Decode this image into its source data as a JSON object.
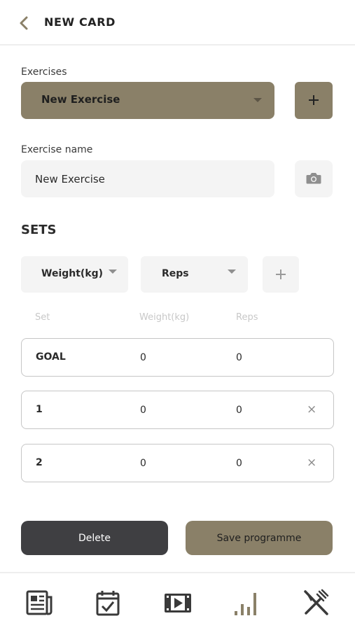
{
  "header": {
    "title": "NEW CARD",
    "back_icon": "chevron-left-icon"
  },
  "exercises": {
    "label": "Exercises",
    "selected": "New Exercise",
    "add_icon": "plus-icon"
  },
  "exercise_name": {
    "label": "Exercise name",
    "value": "New Exercise",
    "camera_icon": "camera-icon"
  },
  "sets": {
    "title": "SETS",
    "column_selectors": [
      {
        "value": "Weight(kg)"
      },
      {
        "value": "Reps"
      }
    ],
    "add_column_icon": "plus-icon",
    "headers": [
      "Set",
      "Weight(kg)",
      "Reps"
    ],
    "rows": [
      {
        "set": "GOAL",
        "weight": "0",
        "reps": "0",
        "removable": false
      },
      {
        "set": "1",
        "weight": "0",
        "reps": "0",
        "remove": "×"
      },
      {
        "set": "2",
        "weight": "0",
        "reps": "0",
        "remove": "×"
      }
    ]
  },
  "actions": {
    "delete_label": "Delete",
    "save_label": "Save programme"
  },
  "bottom_nav": {
    "items": [
      {
        "icon": "news-icon"
      },
      {
        "icon": "calendar-check-icon"
      },
      {
        "icon": "video-icon"
      },
      {
        "icon": "stats-icon",
        "active": true
      },
      {
        "icon": "fork-knife-icon"
      }
    ]
  },
  "colors": {
    "accent": "#8a8068",
    "dark_button": "#3f3f42",
    "field_bg": "#f4f4f4"
  }
}
